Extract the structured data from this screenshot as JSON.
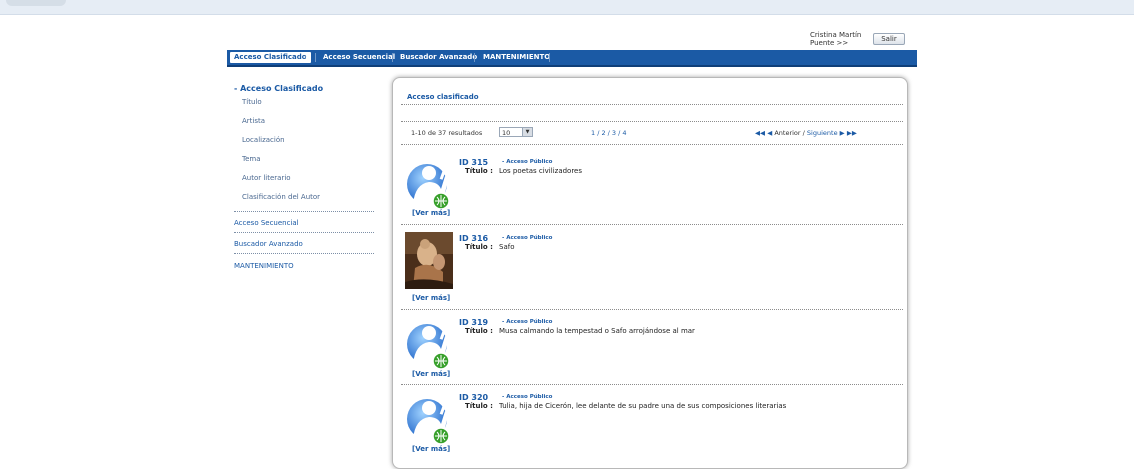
{
  "user": {
    "name": "Cristina Martín",
    "surname_line": "Puente >>",
    "logout_label": "Salir"
  },
  "nav": {
    "active_label": "Acceso Clasificado",
    "caret": "▾",
    "items": [
      "Acceso Secuencial",
      "Buscador Avanzado",
      "MANTENIMIENTO"
    ]
  },
  "sidebar": {
    "heading": "- Acceso Clasificado",
    "sub_items": [
      "Título",
      "Artista",
      "Localización",
      "Tema",
      "Autor literario",
      "Clasificación del Autor"
    ],
    "main_items": [
      "Acceso Secuencial",
      "Buscador Avanzado",
      "MANTENIMIENTO"
    ]
  },
  "panel": {
    "title": "Acceso clasificado",
    "results_text": "1-10 de 37 resultados",
    "page_size": "10",
    "pages": "1 / 2 / 3 / 4",
    "prev_arrows": "◀◀ ◀",
    "prev_label": "Anterior /",
    "next_label": "Siguiente",
    "next_arrows": "▶ ▶▶"
  },
  "records": [
    {
      "id_label": "ID  315",
      "sep": "-",
      "access": "Acceso Público",
      "title_label": "Título :",
      "title": "Los poetas civilizadores",
      "more": "[Ver más]",
      "thumb": "generic-person-icon"
    },
    {
      "id_label": "ID  316",
      "sep": "-",
      "access": "Acceso Público",
      "title_label": "Título :",
      "title": "Safo",
      "more": "[Ver más]",
      "thumb": "painting-thumbnail"
    },
    {
      "id_label": "ID  319",
      "sep": "-",
      "access": "Acceso Público",
      "title_label": "Título :",
      "title": "Musa calmando la tempestad o Safo arrojándose al mar",
      "more": "[Ver más]",
      "thumb": "generic-person-icon"
    },
    {
      "id_label": "ID  320",
      "sep": "-",
      "access": "Acceso Público",
      "title_label": "Título :",
      "title": "Tulia, hija de Cicerón, lee delante de su padre una de sus composiciones literarias",
      "more": "[Ver más]",
      "thumb": "generic-person-icon"
    }
  ],
  "colors": {
    "brand_blue": "#1b5aa5",
    "nav_dark": "#0f3e78"
  }
}
